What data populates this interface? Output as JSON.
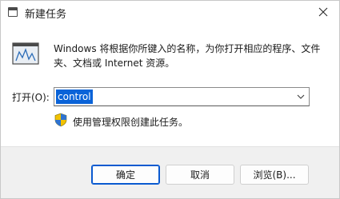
{
  "window": {
    "title": "新建任务",
    "description": "Windows 将根据你所键入的名称，为你打开相应的程序、文件夹、文档或 Internet 资源。",
    "open_label": "打开(O):",
    "open_value": "control",
    "admin_text": "使用管理权限创建此任务。"
  },
  "buttons": {
    "ok": "确定",
    "cancel": "取消",
    "browse": "浏览(B)..."
  },
  "colors": {
    "selection": "#0a63d8",
    "primary_border": "#0a5ad0"
  },
  "icons": {
    "title": "task-window-icon",
    "close": "close-icon",
    "run": "run-program-icon",
    "combo": "chevron-down-icon",
    "admin": "uac-shield-icon"
  }
}
